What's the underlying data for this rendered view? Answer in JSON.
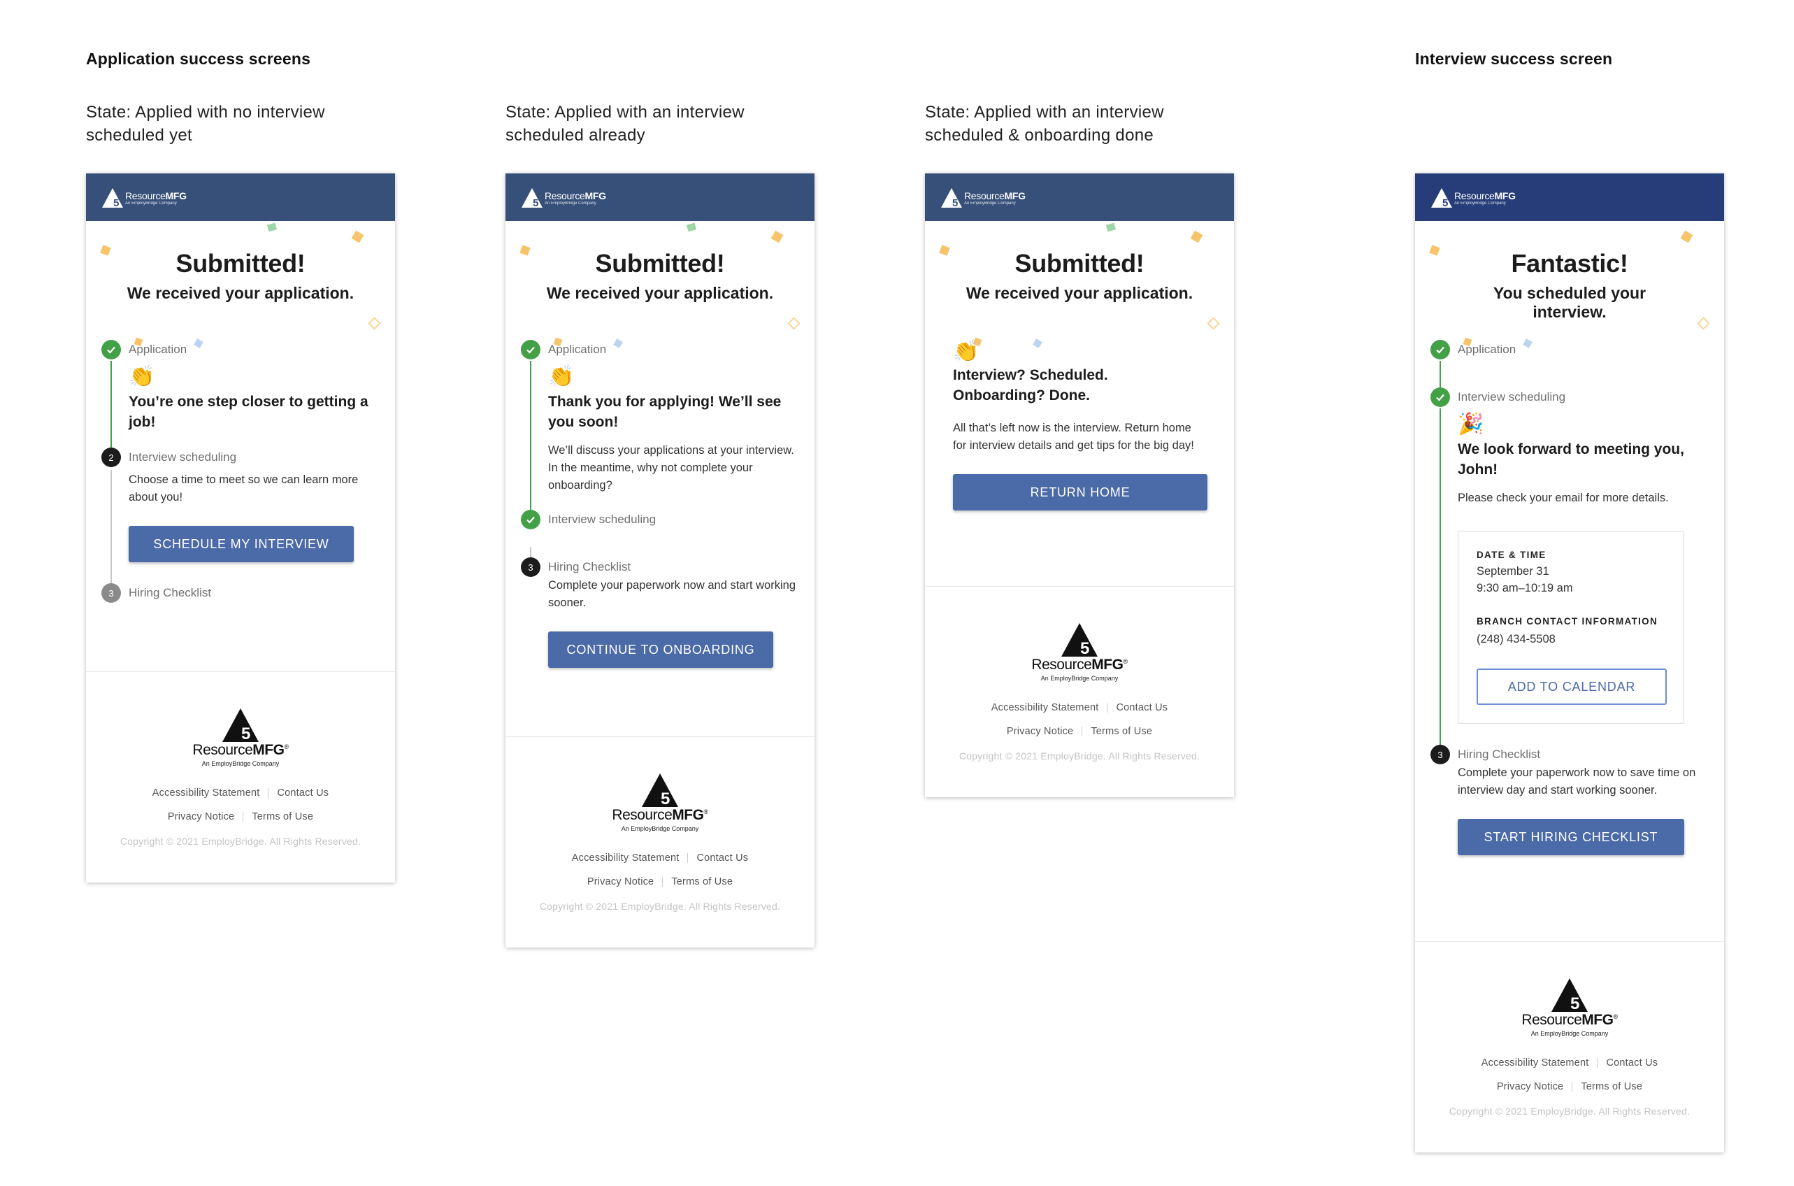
{
  "headings": {
    "application_section": "Application success screens",
    "interview_section": "Interview success screen"
  },
  "states": [
    "State: Applied with no interview scheduled yet",
    "State: Applied with an interview scheduled already",
    "State: Applied with an interview scheduled & onboarding done"
  ],
  "brand": {
    "name_light": "Resource",
    "name_bold": "MFG",
    "reg": "®",
    "tagline": "An EmployBridge Company",
    "header_color": "#37507a",
    "header_color_alt": "#263d7a",
    "button_color": "#4b6aa8",
    "success_color": "#43a047"
  },
  "footer": {
    "accessibility": "Accessibility Statement",
    "contact": "Contact Us",
    "privacy": "Privacy Notice",
    "terms": "Terms of Use",
    "copyright": "Copyright © 2021 EmployBridge. All Rights Reserved."
  },
  "screen1": {
    "title": "Submitted!",
    "subtitle": "We received your application.",
    "step1_label": "Application",
    "step1_emoji": "👏",
    "step1_heading": "You’re one step closer to getting a job!",
    "step2_number": "2",
    "step2_label": "Interview scheduling",
    "step2_text": "Choose a time to meet so we can learn more about you!",
    "button": "SCHEDULE MY INTERVIEW",
    "step3_number": "3",
    "step3_label": "Hiring Checklist"
  },
  "screen2": {
    "title": "Submitted!",
    "subtitle": "We received your application.",
    "step1_label": "Application",
    "step1_emoji": "👏",
    "step1_heading": "Thank you for applying! We’ll see you soon!",
    "step1_text": "We’ll discuss your applications at your interview. In the meantime, why not complete your onboarding?",
    "step2_label": "Interview scheduling",
    "step3_number": "3",
    "step3_label": "Hiring Checklist",
    "step3_text": "Complete your paperwork now and start working sooner.",
    "button": "CONTINUE TO ONBOARDING"
  },
  "screen3": {
    "title": "Submitted!",
    "subtitle": "We received your application.",
    "emoji": "👏",
    "heading": "Interview? Scheduled. Onboarding? Done.",
    "text": "All that’s left now is the interview. Return home for interview details and get tips for the big day!",
    "button": "RETURN HOME"
  },
  "screen4": {
    "title": "Fantastic!",
    "subtitle": "You scheduled your interview.",
    "step1_label": "Application",
    "step2_label": "Interview scheduling",
    "step2_emoji": "🎉",
    "step2_heading": "We look forward to meeting you, John!",
    "step2_text": "Please check your email for more details.",
    "date_time_label": "DATE & TIME",
    "date": "September 31",
    "time": "9:30 am–10:19 am",
    "branch_label": "BRANCH CONTACT INFORMATION",
    "phone": "(248) 434-5508",
    "calendar_button": "ADD TO CALENDAR",
    "step3_number": "3",
    "step3_label": "Hiring Checklist",
    "step3_text": "Complete your paperwork now to save time on interview day and start working sooner.",
    "button": "START HIRING CHECKLIST"
  }
}
